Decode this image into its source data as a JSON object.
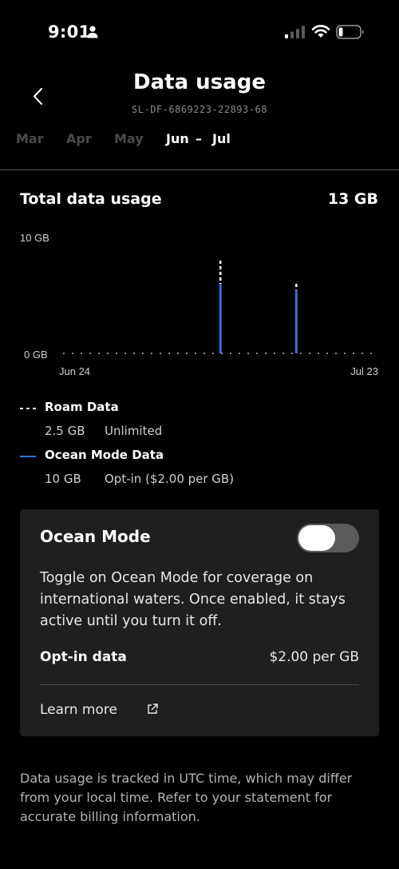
{
  "status_bar": {
    "time": "9:01",
    "icons": [
      "person-icon",
      "signal-icon",
      "wifi-icon",
      "battery-icon"
    ]
  },
  "header": {
    "title": "Data usage",
    "account_id": "SL-DF-6869223-22893-68",
    "back_icon": "chevron-left-icon"
  },
  "month_tabs": {
    "items": [
      "Mar",
      "Apr",
      "May"
    ],
    "active_start": "Jun",
    "separator": "–",
    "active_end": "Jul"
  },
  "total": {
    "label": "Total data usage",
    "value": "13 GB"
  },
  "chart_data": {
    "type": "bar",
    "y_tick_labels": [
      "10 GB",
      "0 GB"
    ],
    "ylim": [
      0,
      10
    ],
    "x_tick_labels": [
      "Jun 24",
      "Jul 23"
    ],
    "series": [
      {
        "name": "Roam Data",
        "style": "dashed",
        "color": "#ffffff",
        "points": [
          {
            "x": "Jun 24 + 14d",
            "y": 2.0
          },
          {
            "x": "Jun 24 + 21d",
            "y": 0.5
          }
        ]
      },
      {
        "name": "Ocean Mode Data",
        "style": "solid",
        "color": "#3b6fd8",
        "points": [
          {
            "x": "Jun 24 + 14d",
            "y": 6.0
          },
          {
            "x": "Jun 24 + 21d",
            "y": 5.5
          }
        ]
      }
    ],
    "grid": false
  },
  "legend": {
    "roam": {
      "title": "Roam Data",
      "amount": "2.5 GB",
      "note": "Unlimited",
      "color": "#ffffff"
    },
    "ocean": {
      "title": "Ocean Mode Data",
      "amount": "10 GB",
      "note": "Opt-in ($2.00 per GB)",
      "color": "#3b6fd8"
    }
  },
  "ocean_card": {
    "title": "Ocean Mode",
    "toggle_on": false,
    "description": "Toggle on Ocean Mode for coverage on international waters. Once enabled, it stays active until you turn it off.",
    "optin_label": "Opt-in data",
    "optin_value": "$2.00 per GB",
    "learn_more": "Learn more",
    "learn_more_icon": "external-link-icon"
  },
  "footer": {
    "note": "Data usage is tracked in UTC time, which may differ from your local time. Refer to your statement for accurate billing information."
  }
}
